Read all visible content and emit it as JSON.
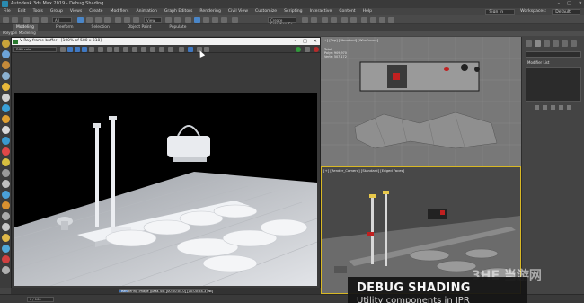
{
  "window": {
    "title": "Autodesk 3ds Max 2019 - Debug Shading",
    "buttons": [
      "–",
      "□",
      "✕"
    ]
  },
  "menubar": {
    "items": [
      "File",
      "Edit",
      "Tools",
      "Group",
      "Views",
      "Create",
      "Modifiers",
      "Animation",
      "Graph Editors",
      "Rendering",
      "Civil View",
      "Customize",
      "Scripting",
      "Interactive",
      "Content",
      "Help"
    ],
    "signin": "Sign In",
    "workspaces_label": "Workspaces:",
    "workspace": "Default"
  },
  "toolbar": {
    "filter": "All",
    "view": "View",
    "selection_set": "Create Selection Se"
  },
  "ribbon": {
    "tabs": [
      "Modeling",
      "Freeform",
      "Selection",
      "Object Paint",
      "Populate"
    ],
    "active_tab": "Modeling",
    "subtitle": "Polygon Modeling"
  },
  "vfb": {
    "title": "V-Ray frame buffer - [100% of 580 x 318]",
    "channel": "RGB color",
    "progress_text": "Rendering image (pass 45) [00:00:05.0] [00:00:54.3 est]",
    "progress": 0.1
  },
  "bottom": {
    "frame": "0 / 100"
  },
  "viewports": {
    "top": {
      "label": "[+] [Top] [Standard] [Wireframe]",
      "stats": [
        "Total",
        "Polys: 909,970",
        "Verts: 507,172"
      ]
    },
    "camera": {
      "label": "[+] [Render_Camera] [Standard] [Edged Faces]"
    }
  },
  "command_panel": {
    "modifier_list": "Modifier List"
  },
  "overlay": {
    "title": "DEBUG SHADING",
    "subtitle": "Utility components in IPR"
  },
  "watermark": "3HE 当游网",
  "colors": {
    "accent_blue": "#4a86c8",
    "active_viewport_border": "#d8b825",
    "vray_green": "#2a7a30"
  }
}
